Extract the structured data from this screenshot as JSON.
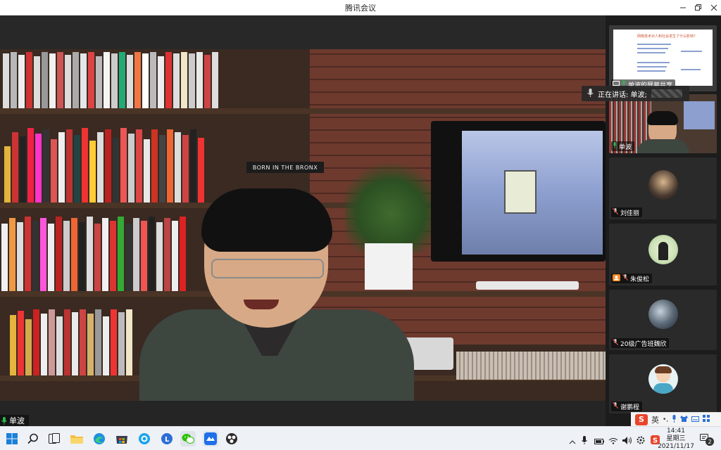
{
  "window": {
    "title": "腾讯会议",
    "controls": [
      "minimize-icon",
      "maximize-icon",
      "close-icon"
    ]
  },
  "main_video": {
    "speaker_name": "单波",
    "backdrop_text": "BORN IN THE BRONX"
  },
  "speaking_tip": {
    "label": "正在讲话: 单波;"
  },
  "sidebar": {
    "tiles": [
      {
        "name": "单波的屏幕共享",
        "type": "screen-share",
        "slide_title": "网络技术对人和社会发生了什么影响?"
      },
      {
        "name": "单波",
        "type": "video"
      },
      {
        "name": "刘佳丽",
        "type": "avatar",
        "mic": "muted"
      },
      {
        "name": "朱俊松",
        "type": "avatar",
        "mic": "muted"
      },
      {
        "name": "20级广告班魏欣",
        "type": "avatar",
        "mic": "muted"
      },
      {
        "name": "谢鹏程",
        "type": "avatar",
        "mic": "muted"
      }
    ]
  },
  "ime": {
    "logo": "S",
    "lang": "英"
  },
  "taskbar": {
    "apps": [
      "windows-start-icon",
      "search-icon",
      "task-view-icon",
      "file-explorer-icon",
      "edge-icon",
      "store-icon",
      "qq-browser-icon",
      "app-l-icon",
      "wechat-icon",
      "tencent-meeting-icon",
      "obs-icon"
    ],
    "tray_icons": [
      "chevron-up-icon",
      "microphone-icon",
      "battery-icon",
      "wifi-icon",
      "volume-icon",
      "settings-icon",
      "sogou-icon"
    ],
    "clock_time": "14:41",
    "clock_weekday": "星期三",
    "clock_date": "2021/11/17",
    "notification_count": "2"
  },
  "colors": {
    "sidebar_bg": "#1c1c1c",
    "taskbar_bg": "#eef1f6",
    "ime_red": "#e9452c",
    "mic_green": "#2fb84f",
    "mic_muted_red": "#e24b3b"
  }
}
